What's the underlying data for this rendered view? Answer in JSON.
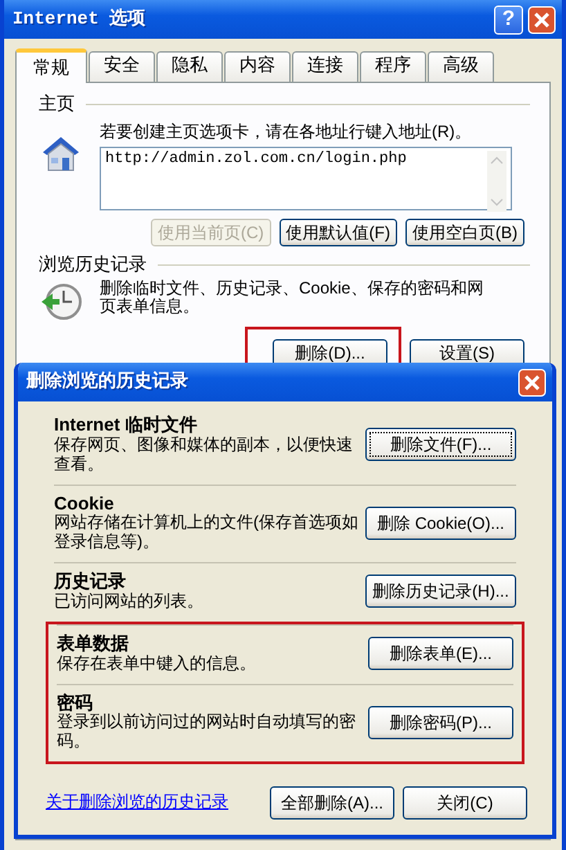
{
  "window": {
    "title": "Internet 选项",
    "help_button": "?"
  },
  "tabs": [
    {
      "label": "常规",
      "selected": true
    },
    {
      "label": "安全",
      "selected": false
    },
    {
      "label": "隐私",
      "selected": false
    },
    {
      "label": "内容",
      "selected": false
    },
    {
      "label": "连接",
      "selected": false
    },
    {
      "label": "程序",
      "selected": false
    },
    {
      "label": "高级",
      "selected": false
    }
  ],
  "home_page": {
    "heading": "主页",
    "instruction": "若要创建主页选项卡，请在各地址行键入地址(R)。",
    "address": "http://admin.zol.com.cn/login.php",
    "buttons": [
      {
        "label": "使用当前页(C)",
        "disabled": true
      },
      {
        "label": "使用默认值(F)",
        "disabled": false
      },
      {
        "label": "使用空白页(B)",
        "disabled": false
      }
    ]
  },
  "browsing_history": {
    "heading": "浏览历史记录",
    "description": "删除临时文件、历史记录、Cookie、保存的密码和网页表单信息。",
    "buttons": [
      {
        "label": "删除(D)...",
        "highlighted": true
      },
      {
        "label": "设置(S)",
        "highlighted": false
      }
    ]
  },
  "dialog": {
    "title": "删除浏览的历史记录",
    "groups": [
      {
        "highlighted": false,
        "items": [
          {
            "title": "Internet 临时文件",
            "description": "保存网页、图像和媒体的副本，以便快速查看。",
            "button": "删除文件(F)...",
            "focused": true
          },
          {
            "title": "Cookie",
            "description": "网站存储在计算机上的文件(保存首选项如登录信息等)。",
            "button": "删除 Cookie(O)...",
            "focused": false
          },
          {
            "title": "历史记录",
            "description": "已访问网站的列表。",
            "button": "删除历史记录(H)...",
            "focused": false
          }
        ]
      },
      {
        "highlighted": true,
        "items": [
          {
            "title": "表单数据",
            "description": "保存在表单中键入的信息。",
            "button": "删除表单(E)...",
            "focused": false
          },
          {
            "title": "密码",
            "description": "登录到以前访问过的网站时自动填写的密码。",
            "button": "删除密码(P)...",
            "focused": false
          }
        ]
      }
    ],
    "link": "关于删除浏览的历史记录",
    "buttons": [
      "全部删除(A)...",
      "关闭(C)"
    ]
  }
}
